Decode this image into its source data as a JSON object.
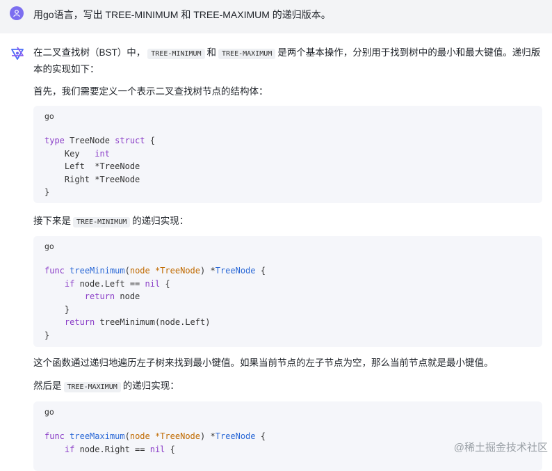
{
  "user_message": "用go语言，写出 TREE-MINIMUM 和 TREE-MAXIMUM 的递归版本。",
  "intro": {
    "part1": "在二叉查找树（BST）中，",
    "code1": "TREE-MINIMUM",
    "part2": "和",
    "code2": "TREE-MAXIMUM",
    "part3": "是两个基本操作，分别用于找到树中的最小和最大键值。递归版本的实现如下："
  },
  "para_struct": "首先，我们需要定义一个表示二叉查找树节点的结构体：",
  "code_struct": {
    "lang": "go",
    "lines": [
      "type TreeNode struct {",
      "    Key   int",
      "    Left  *TreeNode",
      "    Right *TreeNode",
      "}"
    ]
  },
  "para_min": {
    "part1": "接下来是",
    "code": "TREE-MINIMUM",
    "part2": "的递归实现："
  },
  "code_min": {
    "lang": "go",
    "lines": [
      "func treeMinimum(node *TreeNode) *TreeNode {",
      "    if node.Left == nil {",
      "        return node",
      "    }",
      "    return treeMinimum(node.Left)",
      "}"
    ]
  },
  "para_explain": "这个函数通过递归地遍历左子树来找到最小键值。如果当前节点的左子节点为空，那么当前节点就是最小键值。",
  "para_max": {
    "part1": "然后是",
    "code": "TREE-MAXIMUM",
    "part2": "的递归实现："
  },
  "code_max": {
    "lang": "go",
    "lines": [
      "func treeMaximum(node *TreeNode) *TreeNode {",
      "    if node.Right == nil {"
    ]
  },
  "watermark": "@稀土掘金技术社区",
  "colors": {
    "user_bg": "#f3f4f6",
    "avatar": "#7c6ef0",
    "code_bg": "#f5f6fa",
    "keyword": "#8a3dc7",
    "function": "#2a68d6",
    "param": "#c06a00"
  },
  "icons": [
    "user-icon",
    "assistant-logo-icon"
  ]
}
